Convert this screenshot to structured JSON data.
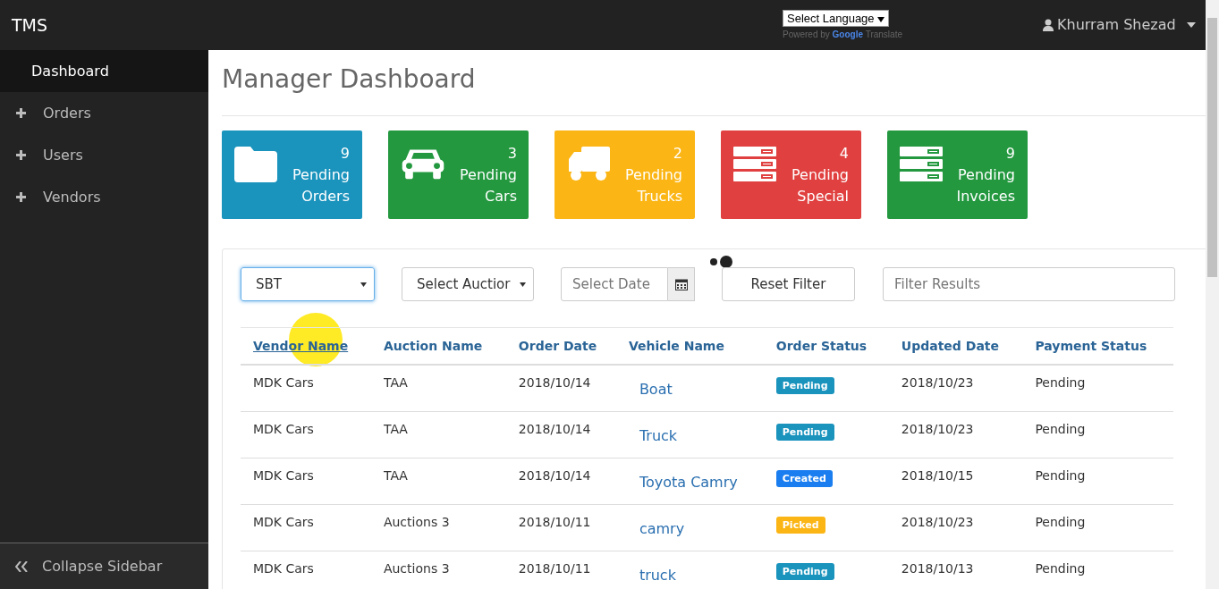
{
  "header": {
    "brand": "TMS",
    "language_select": "Select Language",
    "powered_by": "Powered by",
    "google": "Google",
    "translate": "Translate",
    "user_name": "Khurram Shezad"
  },
  "sidebar": {
    "items": [
      {
        "label": "Dashboard",
        "selected": true,
        "kind": "plain"
      },
      {
        "label": "Orders",
        "selected": false,
        "kind": "expand"
      },
      {
        "label": "Users",
        "selected": false,
        "kind": "expand"
      },
      {
        "label": "Vendors",
        "selected": false,
        "kind": "expand"
      }
    ],
    "collapse": "Collapse Sidebar"
  },
  "page_title": "Manager Dashboard",
  "tiles": [
    {
      "count": "9",
      "label": "Pending Orders",
      "color": "#1a93bd",
      "kind": "folder"
    },
    {
      "count": "3",
      "label": "Pending Cars",
      "color": "#23983f",
      "kind": "car"
    },
    {
      "count": "2",
      "label": "Pending Trucks",
      "color": "#fbb514",
      "kind": "truck"
    },
    {
      "count": "4",
      "label": "Pending Special",
      "color": "#e0403f",
      "kind": "servers"
    },
    {
      "count": "9",
      "label": "Pending Invoices",
      "color": "#23983f",
      "kind": "servers"
    }
  ],
  "filters": {
    "vendor_select": "SBT",
    "auction_select": "Select Auctior",
    "date_placeholder": "Select Date",
    "reset": "Reset Filter",
    "search_placeholder": "Filter Results"
  },
  "table": {
    "columns": [
      "Vendor Name",
      "Auction Name",
      "Order Date",
      "Vehicle Name",
      "Order Status",
      "Updated Date",
      "Payment Status"
    ],
    "rows": [
      {
        "vendor": "MDK Cars",
        "auction": "TAA",
        "order_date": "2018/10/14",
        "vehicle": "Boat",
        "status": {
          "label": "Pending",
          "color": "#1a93bd"
        },
        "updated": "2018/10/23",
        "payment": "Pending"
      },
      {
        "vendor": "MDK Cars",
        "auction": "TAA",
        "order_date": "2018/10/14",
        "vehicle": "Truck",
        "status": {
          "label": "Pending",
          "color": "#1a93bd"
        },
        "updated": "2018/10/23",
        "payment": "Pending"
      },
      {
        "vendor": "MDK Cars",
        "auction": "TAA",
        "order_date": "2018/10/14",
        "vehicle": "Toyota Camry",
        "status": {
          "label": "Created",
          "color": "#1a7ef0"
        },
        "updated": "2018/10/15",
        "payment": "Pending"
      },
      {
        "vendor": "MDK Cars",
        "auction": "Auctions 3",
        "order_date": "2018/10/11",
        "vehicle": "camry",
        "status": {
          "label": "Picked",
          "color": "#fbb514"
        },
        "updated": "2018/10/23",
        "payment": "Pending"
      },
      {
        "vendor": "MDK Cars",
        "auction": "Auctions 3",
        "order_date": "2018/10/11",
        "vehicle": "truck",
        "status": {
          "label": "Pending",
          "color": "#1a93bd"
        },
        "updated": "2018/10/13",
        "payment": "Pending"
      }
    ]
  }
}
